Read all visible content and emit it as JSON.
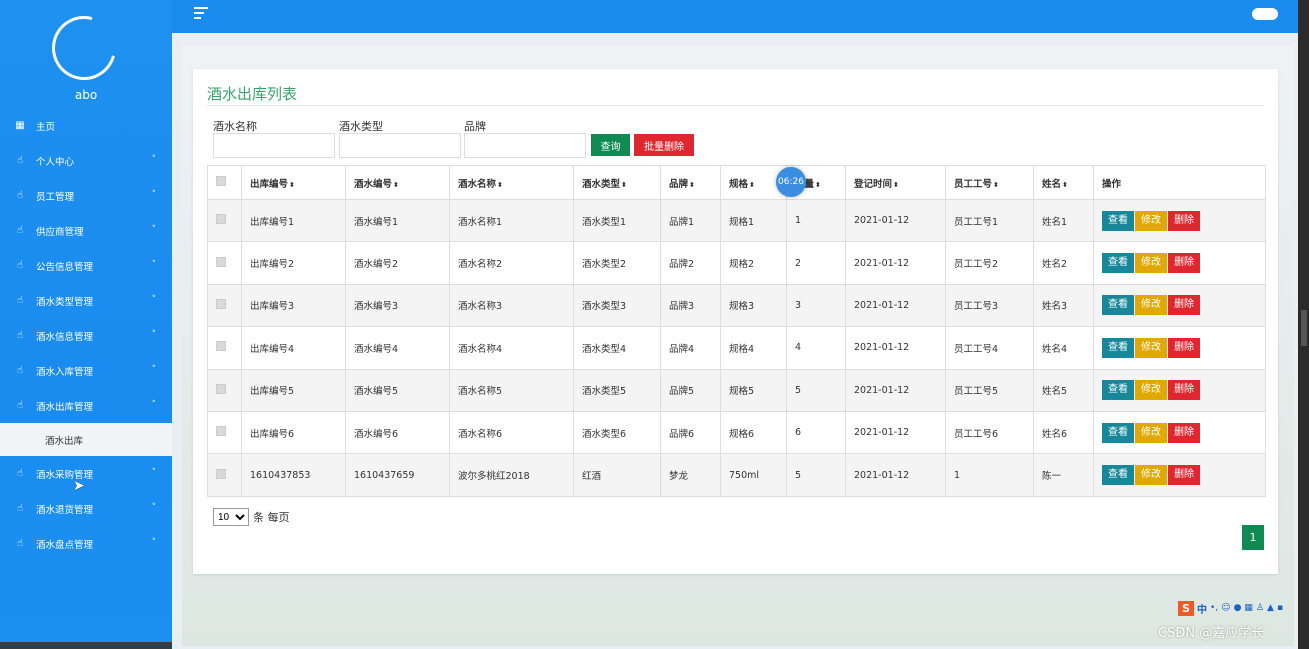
{
  "sidebar": {
    "user_name": "abo",
    "items": [
      {
        "label": "主页",
        "icon": "dashboard-icon",
        "has_chevron": false
      },
      {
        "label": "个人中心",
        "icon": "hand-icon",
        "has_chevron": true
      },
      {
        "label": "员工管理",
        "icon": "hand-icon",
        "has_chevron": true
      },
      {
        "label": "供应商管理",
        "icon": "hand-icon",
        "has_chevron": true
      },
      {
        "label": "公告信息管理",
        "icon": "hand-icon",
        "has_chevron": true
      },
      {
        "label": "酒水类型管理",
        "icon": "hand-icon",
        "has_chevron": true
      },
      {
        "label": "酒水信息管理",
        "icon": "hand-icon",
        "has_chevron": true
      },
      {
        "label": "酒水入库管理",
        "icon": "hand-icon",
        "has_chevron": true
      },
      {
        "label": "酒水出库管理",
        "icon": "hand-icon",
        "has_chevron": true,
        "expanded": true
      }
    ],
    "active_sub": "酒水出库",
    "items_after": [
      {
        "label": "酒水采购管理",
        "icon": "hand-icon"
      },
      {
        "label": "酒水退货管理",
        "icon": "hand-icon"
      },
      {
        "label": "酒水盘点管理",
        "icon": "hand-icon"
      }
    ]
  },
  "main": {
    "title": "酒水出库列表",
    "filters": {
      "name_label": "酒水名称",
      "type_label": "酒水类型",
      "brand_label": "品牌",
      "name_value": "",
      "type_value": "",
      "brand_value": ""
    },
    "buttons": {
      "search": "查询",
      "batch_delete": "批量删除"
    },
    "table": {
      "columns": [
        "出库编号",
        "酒水编号",
        "酒水名称",
        "酒水类型",
        "品牌",
        "规格",
        "数量",
        "登记时间",
        "员工工号",
        "姓名",
        "操作"
      ],
      "rows": [
        [
          "出库编号1",
          "酒水编号1",
          "酒水名称1",
          "酒水类型1",
          "品牌1",
          "规格1",
          "1",
          "2021-01-12",
          "员工工号1",
          "姓名1"
        ],
        [
          "出库编号2",
          "酒水编号2",
          "酒水名称2",
          "酒水类型2",
          "品牌2",
          "规格2",
          "2",
          "2021-01-12",
          "员工工号2",
          "姓名2"
        ],
        [
          "出库编号3",
          "酒水编号3",
          "酒水名称3",
          "酒水类型3",
          "品牌3",
          "规格3",
          "3",
          "2021-01-12",
          "员工工号3",
          "姓名3"
        ],
        [
          "出库编号4",
          "酒水编号4",
          "酒水名称4",
          "酒水类型4",
          "品牌4",
          "规格4",
          "4",
          "2021-01-12",
          "员工工号4",
          "姓名4"
        ],
        [
          "出库编号5",
          "酒水编号5",
          "酒水名称5",
          "酒水类型5",
          "品牌5",
          "规格5",
          "5",
          "2021-01-12",
          "员工工号5",
          "姓名5"
        ],
        [
          "出库编号6",
          "酒水编号6",
          "酒水名称6",
          "酒水类型6",
          "品牌6",
          "规格6",
          "6",
          "2021-01-12",
          "员工工号6",
          "姓名6"
        ],
        [
          "1610437853",
          "1610437659",
          "波尔多桃红2018",
          "红酒",
          "梦龙",
          "750ml",
          "5",
          "2021-01-12",
          "1",
          "陈一"
        ]
      ],
      "actions": {
        "view": "查看",
        "edit": "修改",
        "delete": "删除"
      }
    },
    "pagination": {
      "page_size": "10",
      "page_size_suffix": "条 每页",
      "current_page": "1"
    },
    "timer_badge": "06:26"
  },
  "overlay": {
    "ime_logo": "S",
    "ime_lang": "中",
    "watermark": "CSDN @嘉应学长"
  },
  "colors": {
    "sidebar": "#1a8cf0",
    "title": "#3aa36b",
    "search_button": "#0e8a52",
    "delete_button": "#e0262f",
    "view_button": "#168899",
    "edit_button": "#e0a800"
  }
}
